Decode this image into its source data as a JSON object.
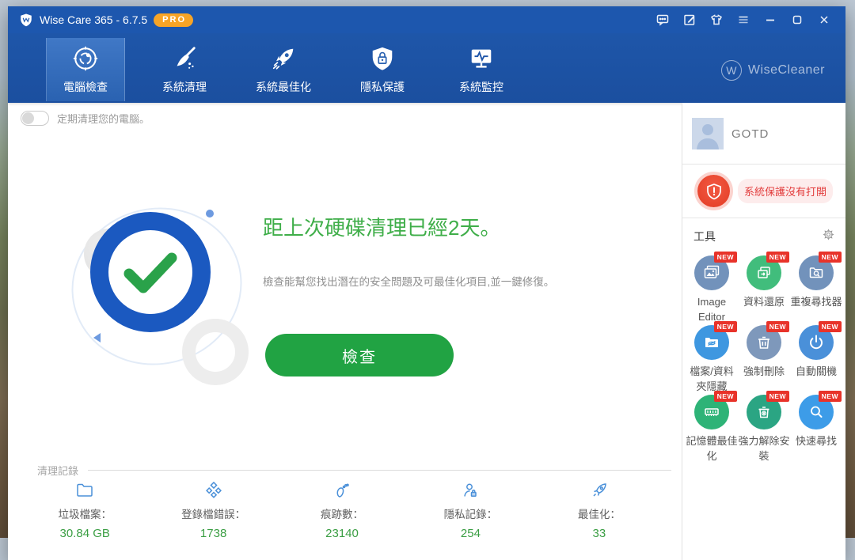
{
  "window": {
    "title": "Wise Care 365 - 6.7.5",
    "pro_badge": "PRO"
  },
  "nav": {
    "brand": "WiseCleaner",
    "brand_initial": "W",
    "tabs": [
      {
        "label": "電腦檢查",
        "active": true
      },
      {
        "label": "系統清理",
        "active": false
      },
      {
        "label": "系統最佳化",
        "active": false
      },
      {
        "label": "隱私保護",
        "active": false
      },
      {
        "label": "系統監控",
        "active": false
      }
    ]
  },
  "toggle": {
    "label": "定期清理您的電腦。",
    "state": "off"
  },
  "main": {
    "heading": "距上次硬碟清理已經2天。",
    "description": "檢查能幫您找出潛在的安全問題及可最佳化項目,並一鍵修復。",
    "check_button": "檢查"
  },
  "cleanup_record": {
    "title": "清理記錄",
    "stats": [
      {
        "icon": "folder-icon",
        "label": "垃圾檔案：",
        "value": "30.84 GB"
      },
      {
        "icon": "registry-icon",
        "label": "登錄檔錯誤：",
        "value": "1738"
      },
      {
        "icon": "footprint-icon",
        "label": "痕跡數：",
        "value": "23140"
      },
      {
        "icon": "privacy-icon",
        "label": "隱私記錄：",
        "value": "254"
      },
      {
        "icon": "rocket-icon",
        "label": "最佳化：",
        "value": "33"
      }
    ]
  },
  "sidebar": {
    "user_name": "GOTD",
    "warning": "系統保護沒有打開",
    "tools_title": "工具",
    "new_badge": "NEW",
    "tools": [
      {
        "label": "Image Editor",
        "icon": "image-editor-icon"
      },
      {
        "label": "資料還原",
        "icon": "data-recovery-icon"
      },
      {
        "label": "重複尋找器",
        "icon": "duplicate-finder-icon"
      },
      {
        "label": "檔案/資料夾隱藏",
        "icon": "folder-hider-icon"
      },
      {
        "label": "強制刪除",
        "icon": "force-delete-icon"
      },
      {
        "label": "自動關機",
        "icon": "auto-shutdown-icon"
      },
      {
        "label": "記憶體最佳化",
        "icon": "memory-optimizer-icon"
      },
      {
        "label": "強力解除安裝",
        "icon": "force-uninstall-icon"
      },
      {
        "label": "快速尋找",
        "icon": "quick-search-icon"
      }
    ]
  },
  "colors": {
    "titlebar": "#1d57ae",
    "accent_green": "#21a343",
    "heading_green": "#3fae49",
    "warning_red": "#e23c3c",
    "pro_orange": "#f7a426",
    "stat_icon_blue": "#4a90d9"
  }
}
